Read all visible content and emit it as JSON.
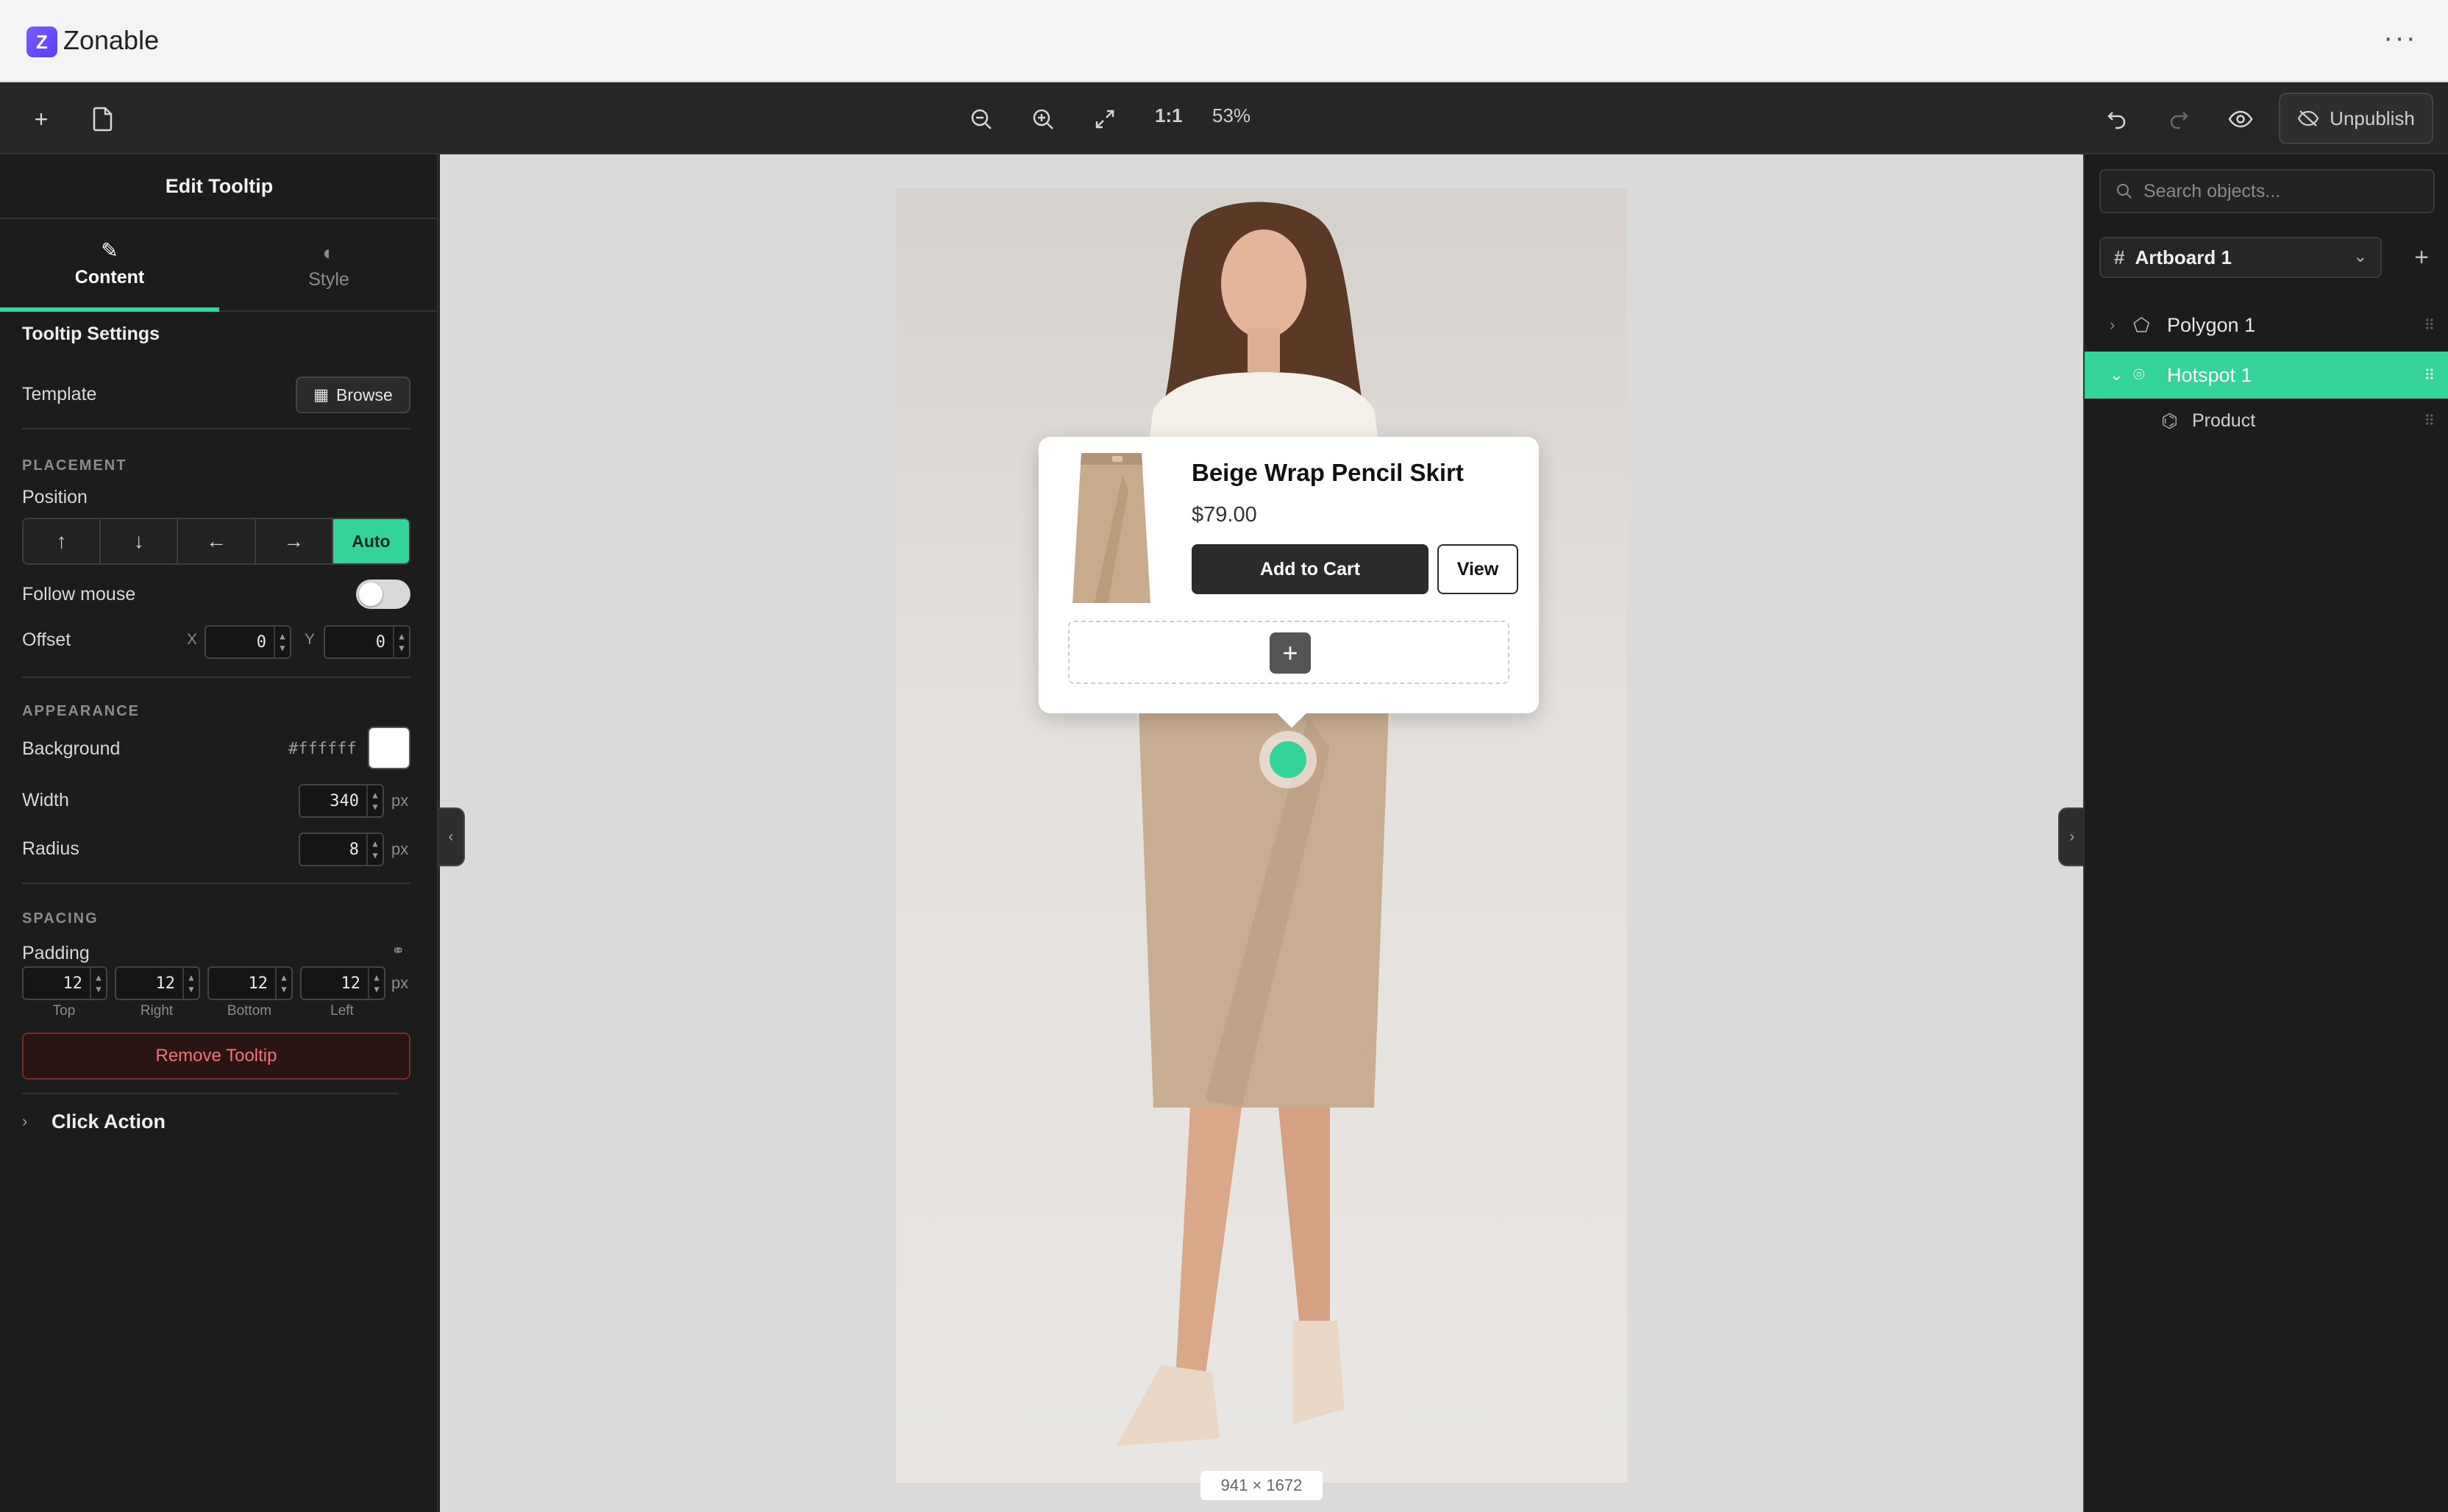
{
  "app": {
    "name": "Zonable",
    "logo_letter": "Z",
    "more_label": "···"
  },
  "toolbar": {
    "add_icon": "+",
    "page_icon": "page-icon",
    "zoom_out_icon": "zoom-out-icon",
    "zoom_in_icon": "zoom-in-icon",
    "fit_icon": "fit-icon",
    "actual_size": "1:1",
    "zoom_level": "53%",
    "undo_icon": "undo-icon",
    "redo_icon": "redo-icon",
    "preview_icon": "eye-icon",
    "unpublish_label": "Unpublish"
  },
  "left_panel": {
    "title": "Edit Tooltip",
    "tabs": [
      {
        "label": "Content",
        "icon": "pencil-icon"
      },
      {
        "label": "Style",
        "icon": "palette-icon"
      }
    ],
    "settings_title": "Tooltip Settings",
    "template_label": "Template",
    "browse_label": "Browse",
    "placement_heading": "PLACEMENT",
    "position_label": "Position",
    "position_options": [
      "↑",
      "↓",
      "←",
      "→",
      "Auto"
    ],
    "position_selected": "Auto",
    "follow_mouse_label": "Follow mouse",
    "follow_mouse": false,
    "offset_label": "Offset",
    "offset_x_label": "X",
    "offset_x": "0",
    "offset_y_label": "Y",
    "offset_y": "0",
    "appearance_heading": "APPEARANCE",
    "background_label": "Background",
    "background_hex": "#ffffff",
    "width_label": "Width",
    "width_value": "340",
    "radius_label": "Radius",
    "radius_value": "8",
    "unit": "px",
    "spacing_heading": "SPACING",
    "padding_label": "Padding",
    "padding": [
      {
        "label": "Top",
        "value": "12"
      },
      {
        "label": "Right",
        "value": "12"
      },
      {
        "label": "Bottom",
        "value": "12"
      },
      {
        "label": "Left",
        "value": "12"
      }
    ],
    "remove_label": "Remove Tooltip",
    "click_action_label": "Click Action"
  },
  "canvas": {
    "dimensions": "941 × 1672",
    "tooltip": {
      "title": "Beige Wrap Pencil Skirt",
      "price": "$79.00",
      "add_to_cart": "Add to Cart",
      "view": "View",
      "add_block": "+"
    }
  },
  "right_panel": {
    "search_placeholder": "Search objects...",
    "artboard_label": "Artboard 1",
    "add_label": "+",
    "layers": [
      {
        "label": "Polygon 1",
        "icon": "polygon-icon",
        "expander": "›"
      },
      {
        "label": "Hotspot 1",
        "icon": "pin-icon",
        "expander": "⌄"
      },
      {
        "label": "Product",
        "icon": "tag-icon",
        "expander": ""
      }
    ]
  },
  "colors": {
    "accent": "#34d399",
    "danger": "#f87171",
    "brand": "#6d4cff"
  }
}
